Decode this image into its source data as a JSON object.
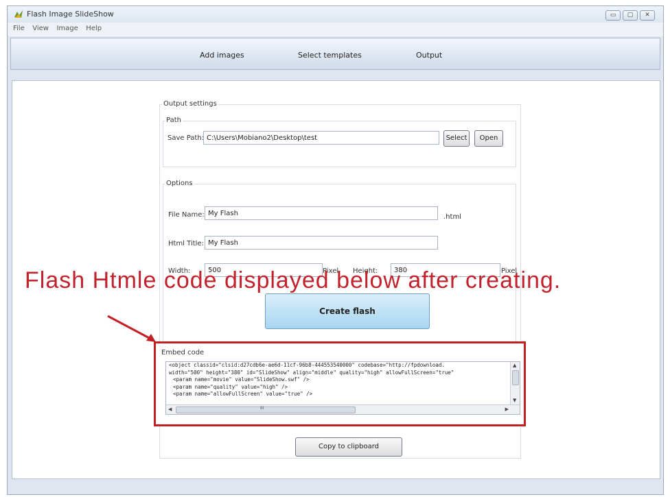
{
  "window": {
    "title": "Flash Image SlideShow",
    "buttons": [
      "▭",
      "▢",
      "✕"
    ]
  },
  "menu": [
    "File",
    "View",
    "Image",
    "Help"
  ],
  "nav": {
    "add_images": "Add images",
    "select_templates": "Select templates",
    "output": "Output"
  },
  "output_settings": {
    "legend": "Output settings",
    "path_legend": "Path",
    "save_path_label": "Save Path:",
    "save_path_value": "C:\\Users\\Mobiano2\\Desktop\\test",
    "select_label": "Select",
    "open_label": "Open"
  },
  "options": {
    "legend": "Options",
    "file_name_label": "File Name:",
    "file_name_value": "My Flash",
    "file_ext": ".html",
    "html_title_label": "Html Title:",
    "html_title_value": "My Flash",
    "width_label": "Width:",
    "width_value": "500",
    "width_unit": "Pixel",
    "height_label": "Height:",
    "height_value": "380",
    "height_unit": "Pixel"
  },
  "create_button": "Create flash",
  "annotation": "Flash Htmle code displayed below after creating.",
  "embed": {
    "legend": "Embed code",
    "lines": [
      "<object classid=\"clsid:d27cdb6e-ae6d-11cf-96b8-444553540000\" codebase=\"http://fpdownload.",
      "width=\"500\" height=\"380\" id=\"SlideShow\" align=\"middle\" quality=\"high\" allowFullScreen=\"true\"",
      "<param name=\"movie\" value=\"SlideShow.swf\" />",
      "<param name=\"quality\" value=\"high\" />",
      "<param name=\"allowFullScreen\" value=\"true\" />"
    ],
    "scroll_indicator": "III"
  },
  "copy_button": "Copy to clipboard",
  "colors": {
    "annotation": "#c2222b",
    "highlight_border": "#c41f25",
    "create_button": "#a9d6f0"
  }
}
